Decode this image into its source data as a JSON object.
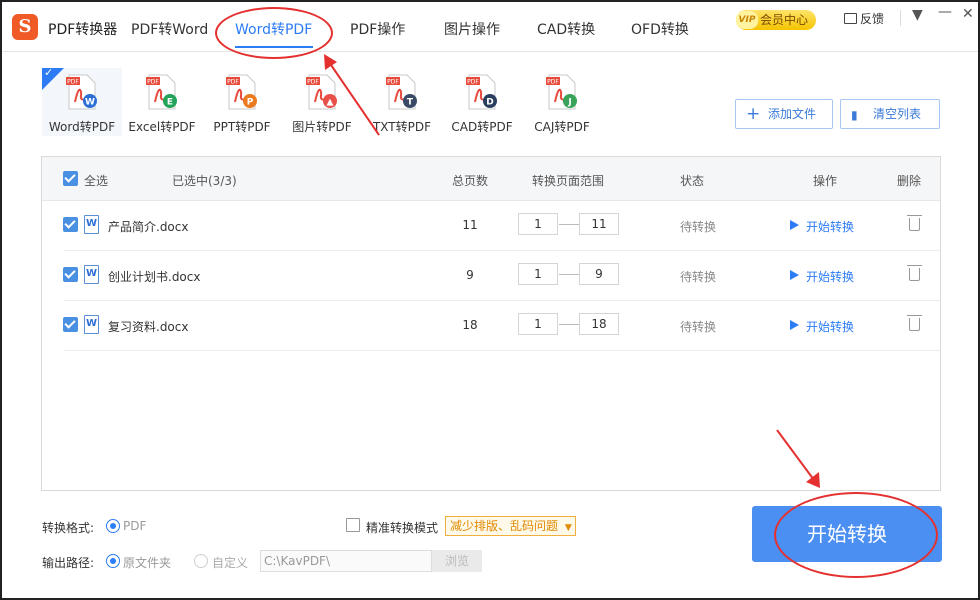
{
  "app": {
    "logo_text": "S",
    "title": "PDF转换器"
  },
  "nav": [
    {
      "label": "PDF转Word",
      "active": false
    },
    {
      "label": "Word转PDF",
      "active": true
    },
    {
      "label": "PDF操作",
      "active": false
    },
    {
      "label": "图片操作",
      "active": false
    },
    {
      "label": "CAD转换",
      "active": false
    },
    {
      "label": "OFD转换",
      "active": false
    }
  ],
  "header_right": {
    "vip_tag": "VIP",
    "vip_label": "会员中心",
    "feedback_label": "反馈",
    "window_controls": [
      "menu-icon",
      "minimize-icon",
      "close-icon"
    ]
  },
  "tools": [
    {
      "label": "Word转PDF",
      "badge": "W",
      "badge_color": "#2d6fd6",
      "active": true
    },
    {
      "label": "Excel转PDF",
      "badge": "E",
      "badge_color": "#22a35a",
      "active": false
    },
    {
      "label": "PPT转PDF",
      "badge": "P",
      "badge_color": "#e87a1f",
      "active": false
    },
    {
      "label": "图片转PDF",
      "badge": "▲",
      "badge_color": "#e8504a",
      "active": false
    },
    {
      "label": "TXT转PDF",
      "badge": "T",
      "badge_color": "#3a4a66",
      "active": false
    },
    {
      "label": "CAD转PDF",
      "badge": "D",
      "badge_color": "#2a3e5e",
      "active": false
    },
    {
      "label": "CAJ转PDF",
      "badge": "J",
      "badge_color": "#3aa35a",
      "active": false
    }
  ],
  "actions": {
    "add_file": "添加文件",
    "clear_list": "清空列表"
  },
  "table": {
    "select_all": "全选",
    "selected_count": "已选中(3/3)",
    "col_pages": "总页数",
    "col_range": "转换页面范围",
    "col_status": "状态",
    "col_op": "操作",
    "col_delete": "删除",
    "rows": [
      {
        "name": "产品简介.docx",
        "pages": "11",
        "from": "1",
        "to": "11",
        "status": "待转换",
        "op": "开始转换"
      },
      {
        "name": "创业计划书.docx",
        "pages": "9",
        "from": "1",
        "to": "9",
        "status": "待转换",
        "op": "开始转换"
      },
      {
        "name": "复习资料.docx",
        "pages": "18",
        "from": "1",
        "to": "18",
        "status": "待转换",
        "op": "开始转换"
      }
    ]
  },
  "settings": {
    "format_label": "转换格式:",
    "format_value": "PDF",
    "precise_mode_label": "精准转换模式",
    "precise_mode_tip": "减少排版、乱码问题",
    "output_label": "输出路径:",
    "output_original": "原文件夹",
    "output_custom": "自定义",
    "path_value": "C:\\KavPDF\\",
    "browse_label": "浏览"
  },
  "start_button": "开始转换",
  "annotation_color": "#e53030"
}
